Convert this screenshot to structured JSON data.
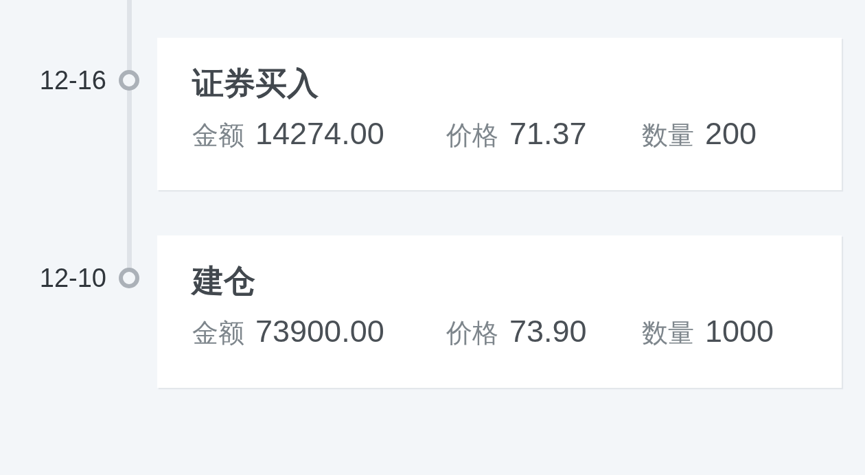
{
  "timeline": [
    {
      "date": "12-16",
      "title": "证券买入",
      "fields": [
        {
          "label": "金额",
          "value": "14274.00"
        },
        {
          "label": "价格",
          "value": "71.37"
        },
        {
          "label": "数量",
          "value": "200"
        }
      ]
    },
    {
      "date": "12-10",
      "title": "建仓",
      "fields": [
        {
          "label": "金额",
          "value": "73900.00"
        },
        {
          "label": "价格",
          "value": "73.90"
        },
        {
          "label": "数量",
          "value": "1000"
        }
      ]
    }
  ]
}
